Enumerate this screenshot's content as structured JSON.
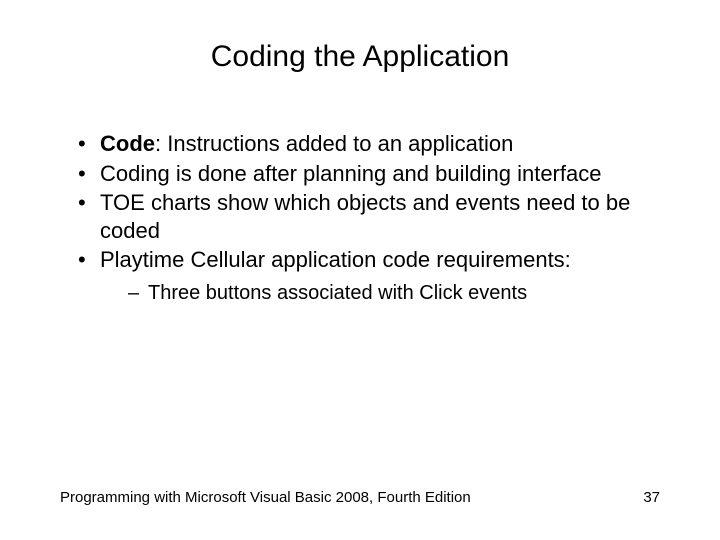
{
  "title": "Coding the Application",
  "bullets": {
    "b1_term": "Code",
    "b1_rest": ": Instructions added to an application",
    "b2": "Coding is done after planning and building interface",
    "b3": "TOE charts show which objects and events need to be coded",
    "b4": "Playtime Cellular application code requirements:",
    "b4_sub1": "Three buttons associated with Click events"
  },
  "footer": {
    "text": "Programming with Microsoft Visual Basic 2008, Fourth Edition",
    "page": "37"
  }
}
